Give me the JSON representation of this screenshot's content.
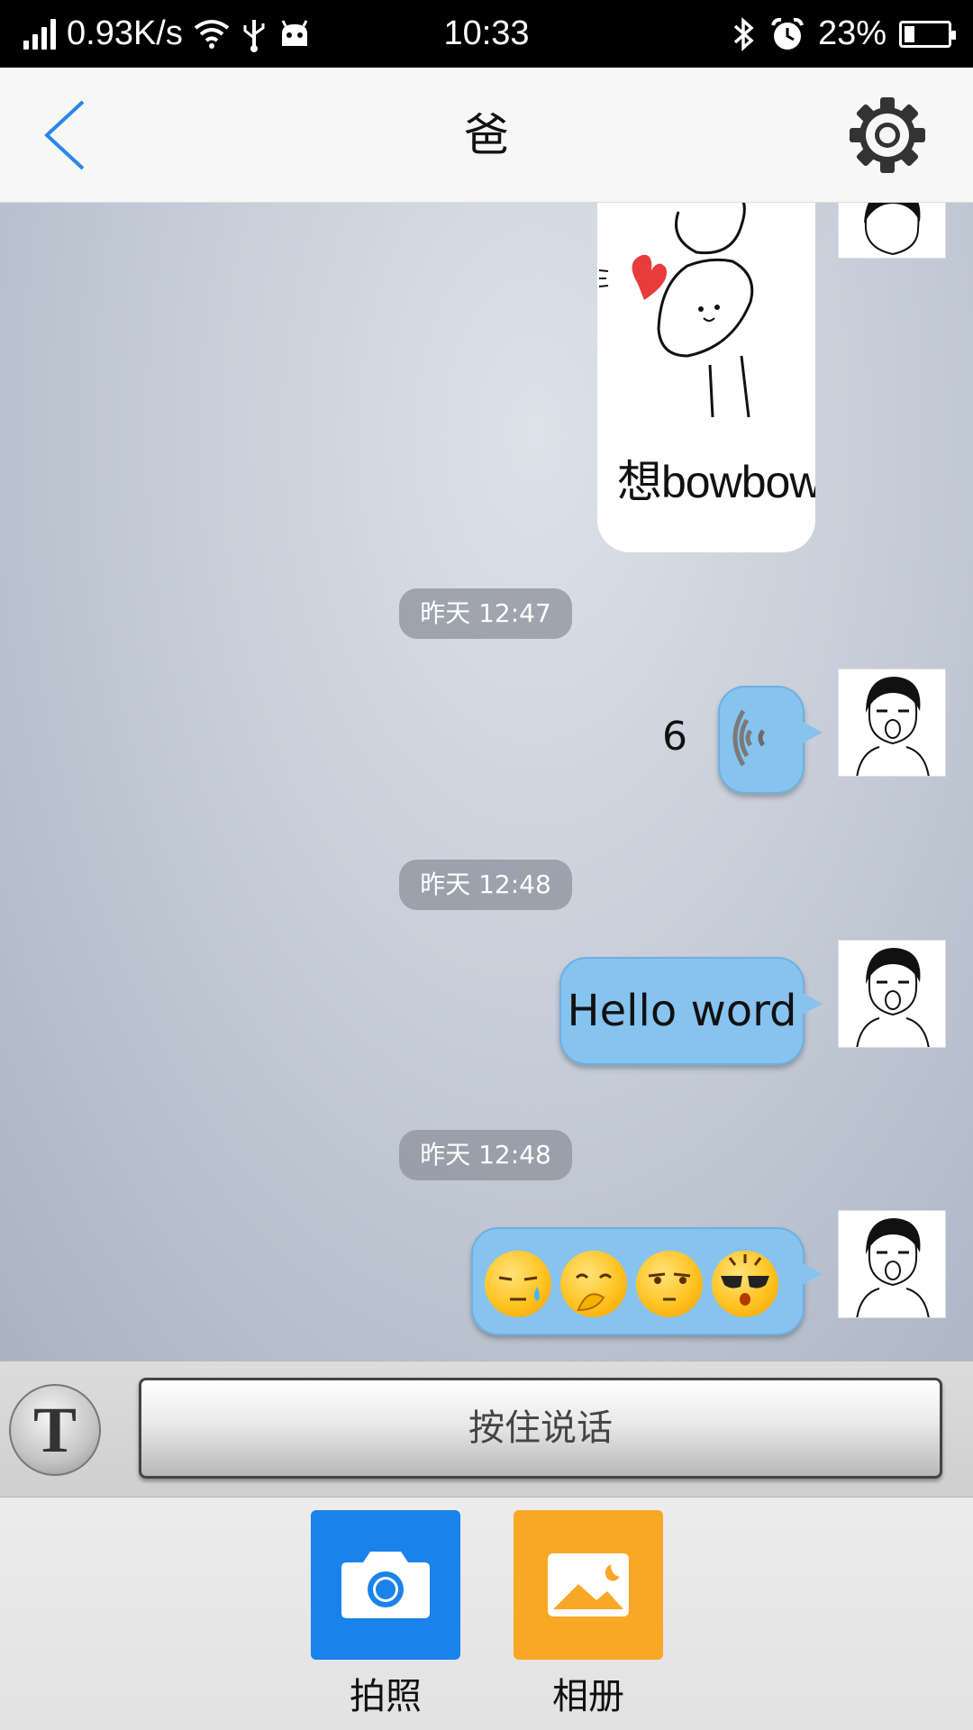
{
  "status_bar": {
    "network_speed": "0.93K/s",
    "time": "10:33",
    "battery": "23%",
    "battery_level": 0.23,
    "icons": [
      "signal-icon",
      "wifi-icon",
      "usb-icon",
      "android-icon",
      "bluetooth-icon",
      "alarm-icon",
      "battery-icon"
    ]
  },
  "header": {
    "title": "爸",
    "back_icon": "chevron-left-icon",
    "settings_icon": "gear-icon"
  },
  "messages": [
    {
      "type": "image",
      "caption": "想bowbow你"
    },
    {
      "type": "timestamp",
      "text": "昨天 12:47"
    },
    {
      "type": "voice",
      "duration": "6"
    },
    {
      "type": "timestamp",
      "text": "昨天 12:48"
    },
    {
      "type": "text",
      "text": "Hello word"
    },
    {
      "type": "timestamp",
      "text": "昨天 12:48"
    },
    {
      "type": "emoji",
      "emojis": [
        "sweat-emoji",
        "yawn-emoji",
        "smirk-emoji",
        "cool-emoji"
      ]
    }
  ],
  "input_bar": {
    "toggle_label": "T",
    "push_to_talk": "按住说话"
  },
  "panel": {
    "camera": {
      "label": "拍照",
      "color": "#1a82eb",
      "icon": "camera-icon"
    },
    "album": {
      "label": "相册",
      "color": "#f9a826",
      "icon": "image-icon"
    }
  },
  "colors": {
    "bubble": "#87c3ef",
    "accent": "#2a86ea"
  }
}
